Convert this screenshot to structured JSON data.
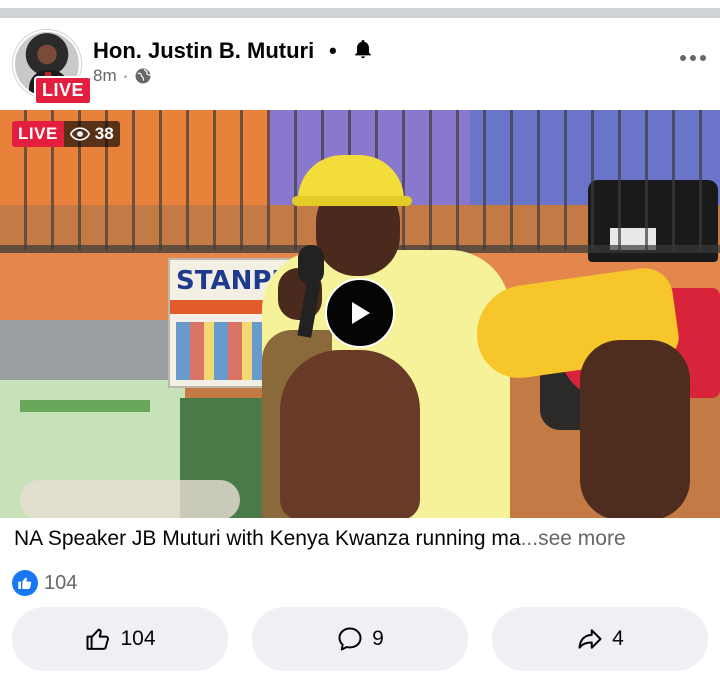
{
  "post": {
    "author": "Hon. Justin B. Muturi",
    "separator": "•",
    "time": "8m",
    "time_separator": "·",
    "avatar_live": "LIVE",
    "icons": {
      "notification": "bell-icon",
      "privacy": "globe-icon",
      "menu": "more-horizontal-icon"
    }
  },
  "video": {
    "live_label": "LIVE",
    "viewer_count": "38",
    "shop_sign": "STANPRO",
    "play_icon": "play-icon"
  },
  "caption": {
    "text": "NA Speaker JB Muturi with Kenya Kwanza running ma",
    "see_more": "...see more"
  },
  "reactions": {
    "count": "104",
    "icon": "like-reaction-icon",
    "color": "#1877f2"
  },
  "actions": {
    "like_count": "104",
    "comment_count": "9",
    "share_count": "4"
  },
  "colors": {
    "live_red": "#e41e3f",
    "secondary_text": "#65676b",
    "pill_bg": "#eef0f3"
  }
}
